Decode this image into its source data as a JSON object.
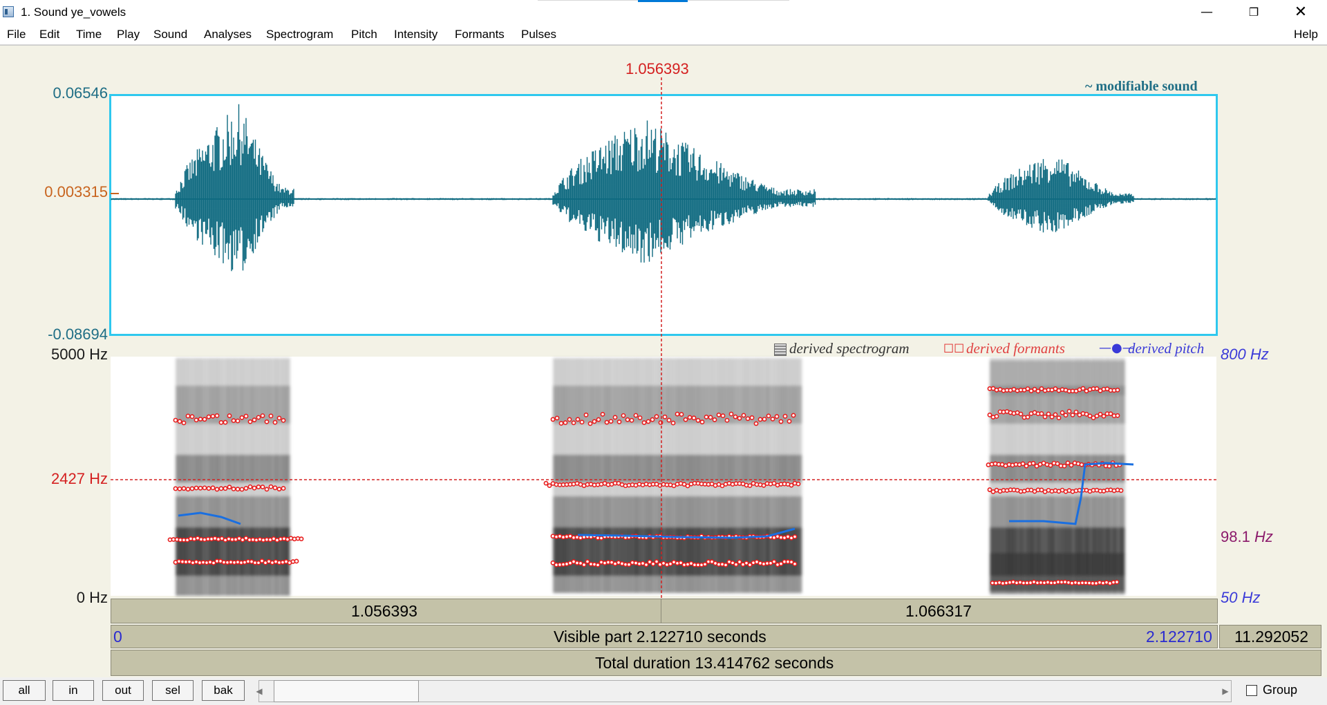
{
  "window": {
    "title": "1. Sound ye_vowels"
  },
  "menu": [
    "File",
    "Edit",
    "Time",
    "Play",
    "Sound",
    "Analyses",
    "Spectrogram",
    "Pitch",
    "Intensity",
    "Formants",
    "Pulses"
  ],
  "menu_help": "Help",
  "cursor": {
    "time_label": "1.056393",
    "freq_label": "2427 Hz"
  },
  "waveform": {
    "y_top": "0.06546",
    "y_mid": "0.003315",
    "y_bottom": "-0.08694",
    "tag": "~ modifiable sound",
    "color": "#0f6a80"
  },
  "spectrogram": {
    "y_top": "5000 Hz",
    "y_bottom": "0 Hz",
    "pitch_top": "800 Hz",
    "pitch_mid_value": "98.1",
    "pitch_mid_unit": "Hz",
    "pitch_bottom": "50 Hz",
    "legend_spectrogram": "derived spectrogram",
    "legend_formants": "derived formants",
    "legend_pitch": "derived pitch"
  },
  "time_bars": {
    "left_segment": "1.056393",
    "right_segment": "1.066317",
    "visible_start": "0",
    "visible_label": "Visible part 2.122710 seconds",
    "visible_end": "2.122710",
    "after_visible": "11.292052",
    "total_label": "Total duration 13.414762 seconds"
  },
  "buttons": {
    "all": "all",
    "in": "in",
    "out": "out",
    "sel": "sel",
    "bak": "bak"
  },
  "group": {
    "label": "Group",
    "checked": false
  },
  "colors": {
    "accent_cyan": "#2ec8ee",
    "cursor_red": "#d42020",
    "pitch_blue": "#1a6fe0",
    "label_orange": "#c8641e",
    "label_teal": "#1f6e85",
    "label_purple": "#8b1a6b",
    "label_blue": "#3a3ad8"
  }
}
